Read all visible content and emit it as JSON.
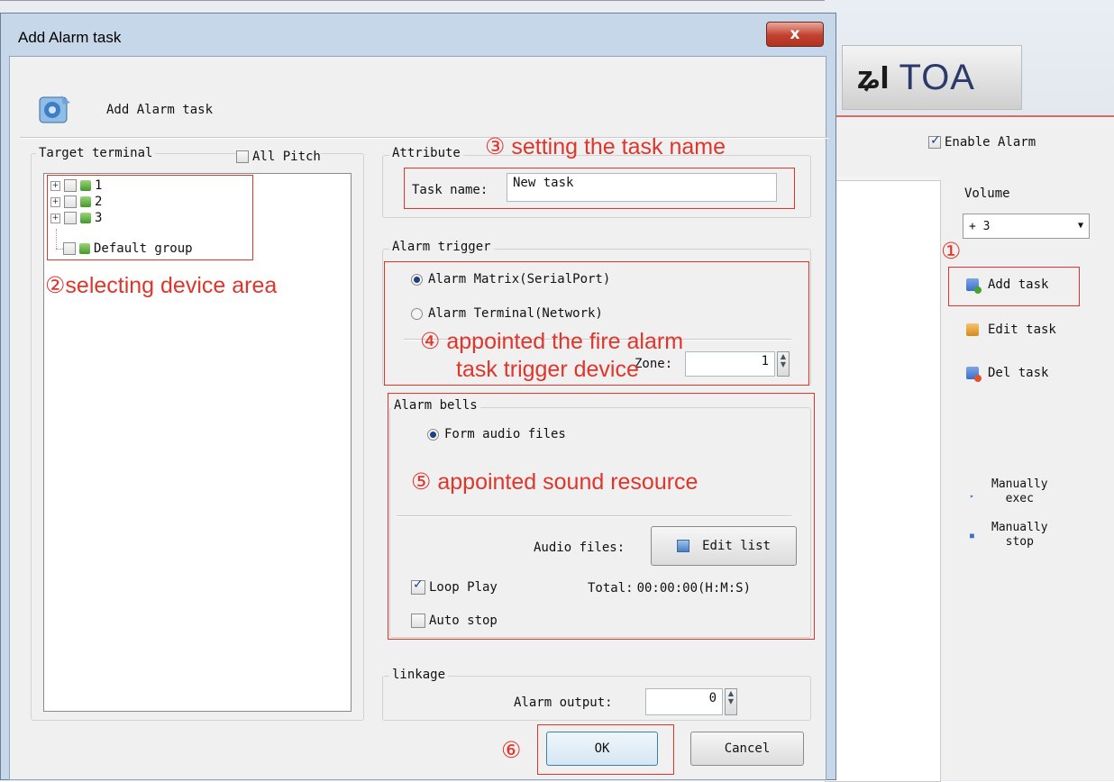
{
  "background_app": {
    "logo_text": "TOA",
    "enable_alarm_label": "Enable Alarm",
    "volume_label": "Volume",
    "volume_value": "+ 3",
    "add_task_label": "Add task",
    "edit_task_label": "Edit task",
    "del_task_label": "Del task",
    "manually_exec_label_1": "Manually",
    "manually_exec_label_2": "exec",
    "manually_stop_label_1": "Manually",
    "manually_stop_label_2": "stop"
  },
  "dialog": {
    "window_title": "Add Alarm task",
    "close_glyph": "x",
    "header_title": "Add Alarm task",
    "target_terminal_label": "Target terminal",
    "all_pitch_label": "All Pitch",
    "tree_items": [
      "1",
      "2",
      "3",
      "Default group"
    ],
    "attribute_label": "Attribute",
    "task_name_label": "Task name:",
    "task_name_value": "New task",
    "alarm_trigger_label": "Alarm trigger",
    "trigger_option_1": "Alarm Matrix(SerialPort)",
    "trigger_option_2": "Alarm Terminal(Network)",
    "zone_label": "Zone:",
    "zone_value": "1",
    "alarm_bells_label": "Alarm bells",
    "form_audio_label": "Form audio files",
    "audio_files_label": "Audio files:",
    "edit_list_label": "Edit list",
    "loop_play_label": "Loop Play",
    "total_label": "Total:",
    "total_value": "00:00:00(H:M:S)",
    "auto_stop_label": "Auto stop",
    "linkage_label": "linkage",
    "alarm_output_label": "Alarm output:",
    "alarm_output_value": "0",
    "ok_label": "OK",
    "cancel_label": "Cancel"
  },
  "annotations": {
    "a1": "①",
    "a2": "②selecting device area",
    "a3": "③ setting the task name",
    "a4_line1": "④ appointed the fire alarm",
    "a4_line2": "task trigger device",
    "a5": "⑤ appointed sound resource",
    "a6": "⑥"
  },
  "colors": {
    "annotation_red": "#e0352b",
    "dialog_frame": "#c6d7ea",
    "dialog_body": "#f0f0f0",
    "close_button": "#c2412f"
  }
}
